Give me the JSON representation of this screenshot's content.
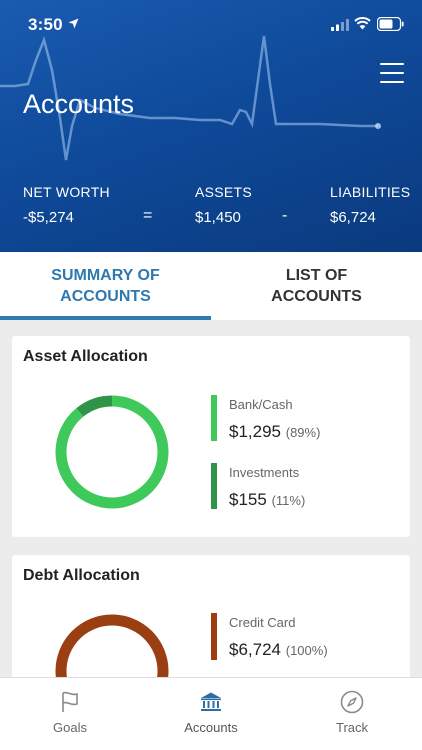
{
  "status_bar": {
    "time": "3:50"
  },
  "header": {
    "title": "Accounts"
  },
  "summary": {
    "net_worth_label": "NET WORTH",
    "net_worth_value": "-$5,274",
    "equals": "=",
    "assets_label": "ASSETS",
    "assets_value": "$1,450",
    "minus": "-",
    "liabilities_label": "LIABILITIES",
    "liabilities_value": "$6,724"
  },
  "tabs": [
    {
      "label_line1": "SUMMARY OF",
      "label_line2": "ACCOUNTS",
      "active": true
    },
    {
      "label_line1": "LIST OF",
      "label_line2": "ACCOUNTS",
      "active": false
    }
  ],
  "asset_allocation": {
    "title": "Asset Allocation",
    "items": [
      {
        "label": "Bank/Cash",
        "amount": "$1,295",
        "percent": "(89%)",
        "fraction": 0.89,
        "color": "#3ec95a"
      },
      {
        "label": "Investments",
        "amount": "$155",
        "percent": "(11%)",
        "fraction": 0.11,
        "color": "#2e9548"
      }
    ]
  },
  "debt_allocation": {
    "title": "Debt Allocation",
    "items": [
      {
        "label": "Credit Card",
        "amount": "$6,724",
        "percent": "(100%)",
        "fraction": 1.0,
        "color": "#9b3f12"
      }
    ]
  },
  "bottom_nav": [
    {
      "label": "Goals",
      "icon": "flag-icon",
      "active": false
    },
    {
      "label": "Accounts",
      "icon": "bank-icon",
      "active": true
    },
    {
      "label": "Track",
      "icon": "compass-icon",
      "active": false
    }
  ],
  "colors": {
    "header_blue": "#0f4a9a",
    "accent_blue": "#2e79b0",
    "nav_active": "#2e6ca4"
  }
}
